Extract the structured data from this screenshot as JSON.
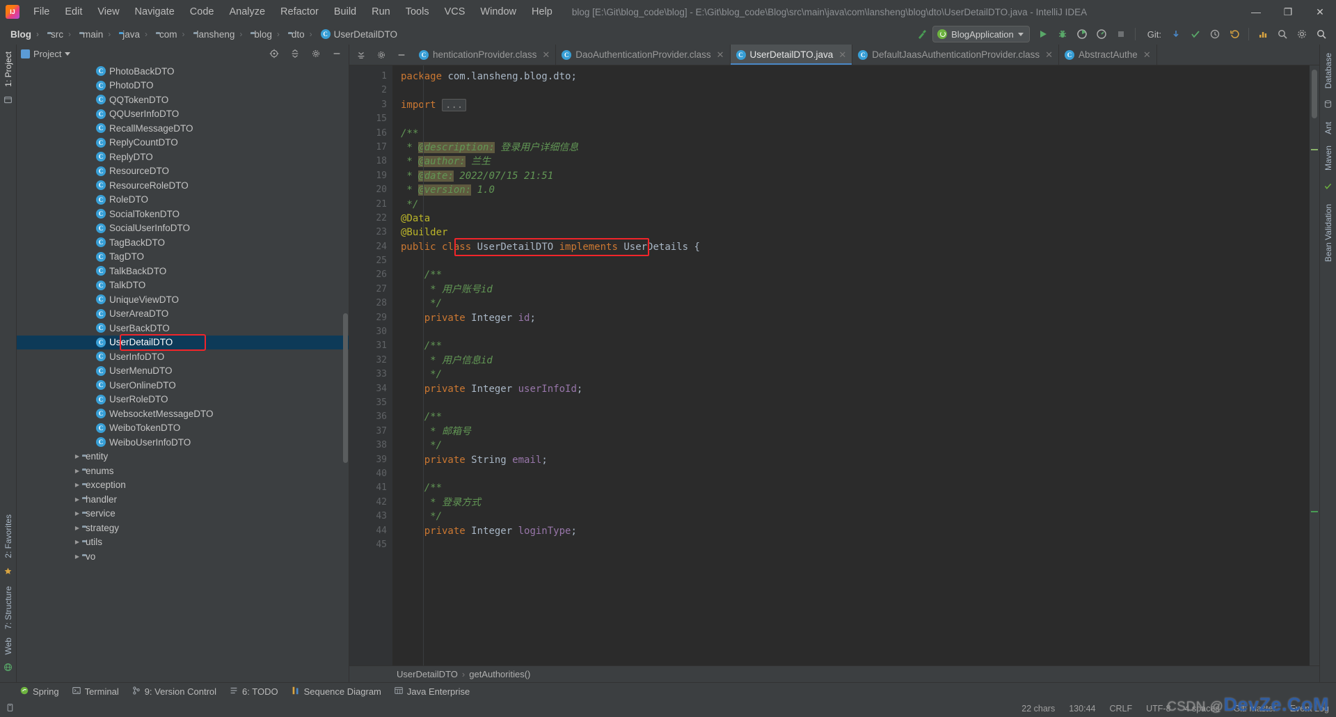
{
  "window": {
    "title": "blog [E:\\Git\\blog_code\\blog] - E:\\Git\\blog_code\\Blog\\src\\main\\java\\com\\lansheng\\blog\\dto\\UserDetailDTO.java - IntelliJ IDEA",
    "minimize": "—",
    "maximize": "❐",
    "close": "✕"
  },
  "menu": [
    "File",
    "Edit",
    "View",
    "Navigate",
    "Code",
    "Analyze",
    "Refactor",
    "Build",
    "Run",
    "Tools",
    "VCS",
    "Window",
    "Help"
  ],
  "breadcrumb": [
    {
      "label": "Blog",
      "icon": "module-icon"
    },
    {
      "label": "src",
      "icon": "folder-icon"
    },
    {
      "label": "main",
      "icon": "folder-icon"
    },
    {
      "label": "java",
      "icon": "source-folder-icon"
    },
    {
      "label": "com",
      "icon": "package-icon"
    },
    {
      "label": "lansheng",
      "icon": "package-icon"
    },
    {
      "label": "blog",
      "icon": "package-icon"
    },
    {
      "label": "dto",
      "icon": "package-icon"
    },
    {
      "label": "UserDetailDTO",
      "icon": "class-icon"
    }
  ],
  "toolbar": {
    "run_config": "BlogApplication",
    "git_label": "Git:",
    "run_tooltip": "Run",
    "debug_tooltip": "Debug",
    "coverage_tooltip": "Run with Coverage",
    "profile_tooltip": "Profile",
    "stop_tooltip": "Stop",
    "build_tooltip": "Build",
    "search_tooltip": "Search Everywhere",
    "settings_tooltip": "Settings",
    "update_tooltip": "Update Project",
    "commit_tooltip": "Commit",
    "history_tooltip": "History",
    "rollback_tooltip": "Rollback"
  },
  "project_panel": {
    "title": "Project",
    "tree": [
      {
        "label": "PhotoBackDTO",
        "type": "class",
        "indent": 5,
        "selected": false
      },
      {
        "label": "PhotoDTO",
        "type": "class",
        "indent": 5,
        "selected": false
      },
      {
        "label": "QQTokenDTO",
        "type": "class",
        "indent": 5,
        "selected": false
      },
      {
        "label": "QQUserInfoDTO",
        "type": "class",
        "indent": 5,
        "selected": false
      },
      {
        "label": "RecallMessageDTO",
        "type": "class",
        "indent": 5,
        "selected": false
      },
      {
        "label": "ReplyCountDTO",
        "type": "class",
        "indent": 5,
        "selected": false
      },
      {
        "label": "ReplyDTO",
        "type": "class",
        "indent": 5,
        "selected": false
      },
      {
        "label": "ResourceDTO",
        "type": "class",
        "indent": 5,
        "selected": false
      },
      {
        "label": "ResourceRoleDTO",
        "type": "class",
        "indent": 5,
        "selected": false
      },
      {
        "label": "RoleDTO",
        "type": "class",
        "indent": 5,
        "selected": false
      },
      {
        "label": "SocialTokenDTO",
        "type": "class",
        "indent": 5,
        "selected": false
      },
      {
        "label": "SocialUserInfoDTO",
        "type": "class",
        "indent": 5,
        "selected": false
      },
      {
        "label": "TagBackDTO",
        "type": "class",
        "indent": 5,
        "selected": false
      },
      {
        "label": "TagDTO",
        "type": "class",
        "indent": 5,
        "selected": false
      },
      {
        "label": "TalkBackDTO",
        "type": "class",
        "indent": 5,
        "selected": false
      },
      {
        "label": "TalkDTO",
        "type": "class",
        "indent": 5,
        "selected": false
      },
      {
        "label": "UniqueViewDTO",
        "type": "class",
        "indent": 5,
        "selected": false
      },
      {
        "label": "UserAreaDTO",
        "type": "class",
        "indent": 5,
        "selected": false
      },
      {
        "label": "UserBackDTO",
        "type": "class",
        "indent": 5,
        "selected": false
      },
      {
        "label": "UserDetailDTO",
        "type": "class",
        "indent": 5,
        "selected": true
      },
      {
        "label": "UserInfoDTO",
        "type": "class",
        "indent": 5,
        "selected": false
      },
      {
        "label": "UserMenuDTO",
        "type": "class",
        "indent": 5,
        "selected": false
      },
      {
        "label": "UserOnlineDTO",
        "type": "class",
        "indent": 5,
        "selected": false
      },
      {
        "label": "UserRoleDTO",
        "type": "class",
        "indent": 5,
        "selected": false
      },
      {
        "label": "WebsocketMessageDTO",
        "type": "class",
        "indent": 5,
        "selected": false
      },
      {
        "label": "WeiboTokenDTO",
        "type": "class",
        "indent": 5,
        "selected": false
      },
      {
        "label": "WeiboUserInfoDTO",
        "type": "class",
        "indent": 5,
        "selected": false
      },
      {
        "label": "entity",
        "type": "folder",
        "indent": 4,
        "expandable": true,
        "selected": false
      },
      {
        "label": "enums",
        "type": "folder",
        "indent": 4,
        "expandable": true,
        "selected": false
      },
      {
        "label": "exception",
        "type": "folder",
        "indent": 4,
        "expandable": true,
        "selected": false
      },
      {
        "label": "handler",
        "type": "folder",
        "indent": 4,
        "expandable": true,
        "selected": false
      },
      {
        "label": "service",
        "type": "folder",
        "indent": 4,
        "expandable": true,
        "selected": false
      },
      {
        "label": "strategy",
        "type": "folder",
        "indent": 4,
        "expandable": true,
        "selected": false
      },
      {
        "label": "utils",
        "type": "folder",
        "indent": 4,
        "expandable": true,
        "selected": false
      },
      {
        "label": "vo",
        "type": "folder",
        "indent": 4,
        "expandable": true,
        "selected": false
      }
    ]
  },
  "editor": {
    "tabs": [
      {
        "label": "henticationProvider.class",
        "active": false,
        "icon": "class-file-icon",
        "truncated": true
      },
      {
        "label": "DaoAuthenticationProvider.class",
        "active": false,
        "icon": "class-file-icon"
      },
      {
        "label": "UserDetailDTO.java",
        "active": true,
        "icon": "java-file-icon"
      },
      {
        "label": "DefaultJaasAuthenticationProvider.class",
        "active": false,
        "icon": "class-file-icon"
      },
      {
        "label": "AbstractAuthe",
        "active": false,
        "icon": "class-file-icon",
        "truncated": true
      }
    ],
    "lines": [
      {
        "n": "1",
        "segs": [
          {
            "t": "package",
            "c": "k"
          },
          {
            "t": " com.lansheng.blog.dto",
            "c": "t"
          },
          {
            "t": ";",
            "c": "t"
          }
        ],
        "indent": 0
      },
      {
        "n": "2",
        "segs": [],
        "indent": 0
      },
      {
        "n": "3",
        "segs": [
          {
            "t": "import",
            "c": "k"
          },
          {
            "t": " ",
            "c": "t"
          },
          {
            "t": "...",
            "c": "ellipsis"
          }
        ],
        "indent": 0,
        "fold": "minus"
      },
      {
        "n": "15",
        "segs": [],
        "indent": 0
      },
      {
        "n": "16",
        "segs": [
          {
            "t": "/**",
            "c": "c"
          }
        ],
        "indent": 0,
        "fold": "minus"
      },
      {
        "n": "17",
        "segs": [
          {
            "t": " * ",
            "c": "c"
          },
          {
            "t": "@description:",
            "c": "tag"
          },
          {
            "t": " 登录用户详细信息",
            "c": "c"
          }
        ],
        "indent": 0
      },
      {
        "n": "18",
        "segs": [
          {
            "t": " * ",
            "c": "c"
          },
          {
            "t": "@author:",
            "c": "tag"
          },
          {
            "t": " 兰生",
            "c": "c"
          }
        ],
        "indent": 0
      },
      {
        "n": "19",
        "segs": [
          {
            "t": " * ",
            "c": "c"
          },
          {
            "t": "@date:",
            "c": "tag"
          },
          {
            "t": " 2022/07/15 21:51",
            "c": "c"
          }
        ],
        "indent": 0
      },
      {
        "n": "20",
        "segs": [
          {
            "t": " * ",
            "c": "c"
          },
          {
            "t": "@version:",
            "c": "tag"
          },
          {
            "t": " 1.0",
            "c": "c"
          }
        ],
        "indent": 0
      },
      {
        "n": "21",
        "segs": [
          {
            "t": " */",
            "c": "c"
          }
        ],
        "indent": 0,
        "fold": "end"
      },
      {
        "n": "22",
        "segs": [
          {
            "t": "@Data",
            "c": "ann"
          }
        ],
        "indent": 0,
        "fold": "minus"
      },
      {
        "n": "23",
        "segs": [
          {
            "t": "@Builder",
            "c": "ann"
          }
        ],
        "indent": 0,
        "fold": "end"
      },
      {
        "n": "24",
        "segs": [
          {
            "t": "public",
            "c": "k"
          },
          {
            "t": " ",
            "c": "t"
          },
          {
            "t": "class",
            "c": "k"
          },
          {
            "t": " UserDetailDTO ",
            "c": "t"
          },
          {
            "t": "implements",
            "c": "k"
          },
          {
            "t": " UserDetails ",
            "c": "t"
          },
          {
            "t": "{",
            "c": "t"
          }
        ],
        "indent": 0
      },
      {
        "n": "25",
        "segs": [],
        "indent": 0
      },
      {
        "n": "26",
        "segs": [
          {
            "t": "    /**",
            "c": "c"
          }
        ],
        "indent": 0,
        "fold": "minus"
      },
      {
        "n": "27",
        "segs": [
          {
            "t": "     * 用户账号id",
            "c": "c"
          }
        ],
        "indent": 0
      },
      {
        "n": "28",
        "segs": [
          {
            "t": "     */",
            "c": "c"
          }
        ],
        "indent": 0,
        "fold": "end"
      },
      {
        "n": "29",
        "segs": [
          {
            "t": "    ",
            "c": "t"
          },
          {
            "t": "private",
            "c": "k"
          },
          {
            "t": " Integer ",
            "c": "t"
          },
          {
            "t": "id",
            "c": "f"
          },
          {
            "t": ";",
            "c": "t"
          }
        ],
        "indent": 0
      },
      {
        "n": "30",
        "segs": [],
        "indent": 0
      },
      {
        "n": "31",
        "segs": [
          {
            "t": "    /**",
            "c": "c"
          }
        ],
        "indent": 0,
        "fold": "minus"
      },
      {
        "n": "32",
        "segs": [
          {
            "t": "     * 用户信息id",
            "c": "c"
          }
        ],
        "indent": 0
      },
      {
        "n": "33",
        "segs": [
          {
            "t": "     */",
            "c": "c"
          }
        ],
        "indent": 0,
        "fold": "end"
      },
      {
        "n": "34",
        "segs": [
          {
            "t": "    ",
            "c": "t"
          },
          {
            "t": "private",
            "c": "k"
          },
          {
            "t": " Integer ",
            "c": "t"
          },
          {
            "t": "userInfoId",
            "c": "f"
          },
          {
            "t": ";",
            "c": "t"
          }
        ],
        "indent": 0
      },
      {
        "n": "35",
        "segs": [],
        "indent": 0
      },
      {
        "n": "36",
        "segs": [
          {
            "t": "    /**",
            "c": "c"
          }
        ],
        "indent": 0,
        "fold": "minus"
      },
      {
        "n": "37",
        "segs": [
          {
            "t": "     * 邮箱号",
            "c": "c"
          }
        ],
        "indent": 0
      },
      {
        "n": "38",
        "segs": [
          {
            "t": "     */",
            "c": "c"
          }
        ],
        "indent": 0,
        "fold": "end"
      },
      {
        "n": "39",
        "segs": [
          {
            "t": "    ",
            "c": "t"
          },
          {
            "t": "private",
            "c": "k"
          },
          {
            "t": " String ",
            "c": "t"
          },
          {
            "t": "email",
            "c": "f"
          },
          {
            "t": ";",
            "c": "t"
          }
        ],
        "indent": 0
      },
      {
        "n": "40",
        "segs": [],
        "indent": 0
      },
      {
        "n": "41",
        "segs": [
          {
            "t": "    /**",
            "c": "c"
          }
        ],
        "indent": 0,
        "fold": "minus"
      },
      {
        "n": "42",
        "segs": [
          {
            "t": "     * 登录方式",
            "c": "c"
          }
        ],
        "indent": 0
      },
      {
        "n": "43",
        "segs": [
          {
            "t": "     */",
            "c": "c"
          }
        ],
        "indent": 0,
        "fold": "end"
      },
      {
        "n": "44",
        "segs": [
          {
            "t": "    ",
            "c": "t"
          },
          {
            "t": "private",
            "c": "k"
          },
          {
            "t": " Integer ",
            "c": "t"
          },
          {
            "t": "loginType",
            "c": "f"
          },
          {
            "t": ";",
            "c": "t"
          }
        ],
        "indent": 0
      },
      {
        "n": "45",
        "segs": [],
        "indent": 0
      }
    ],
    "crumbs": [
      "UserDetailDTO",
      "getAuthorities()"
    ]
  },
  "left_rail": {
    "top": [
      "1: Project"
    ],
    "bottom": [
      "2: Favorites",
      "7: Structure",
      "Web"
    ]
  },
  "right_rail": [
    "Database",
    "Ant",
    "Maven",
    "Bean Validation"
  ],
  "tool_windows": [
    {
      "label": "Spring",
      "icon": "spring-icon",
      "mnemonic": ""
    },
    {
      "label": "Terminal",
      "icon": "terminal-icon",
      "mnemonic": ""
    },
    {
      "label": "9: Version Control",
      "icon": "vcs-icon",
      "mnemonic": "9"
    },
    {
      "label": "6: TODO",
      "icon": "todo-icon",
      "mnemonic": "6"
    },
    {
      "label": "Sequence Diagram",
      "icon": "sequence-diagram-icon",
      "mnemonic": ""
    },
    {
      "label": "Java Enterprise",
      "icon": "java-enterprise-icon",
      "mnemonic": ""
    }
  ],
  "status_bar": {
    "chars": "22 chars",
    "caret": "130:44",
    "line_separator": "CRLF",
    "encoding": "UTF-8",
    "indent": "4 spaces",
    "branch": "Git: master",
    "event_log": "Event Log"
  },
  "watermark": {
    "prefix": "CSDN @",
    "text": "DevZe.CoM"
  },
  "colors": {
    "accent_blue": "#4a88c7",
    "selection": "#0d3a58",
    "annotation_red": "#f2252a",
    "keyword": "#cc7832",
    "comment_green": "#629755",
    "annotation_yellow": "#bbb529",
    "field_purple": "#9876aa",
    "editor_bg": "#2b2b2b",
    "chrome_bg": "#3c3f41"
  }
}
